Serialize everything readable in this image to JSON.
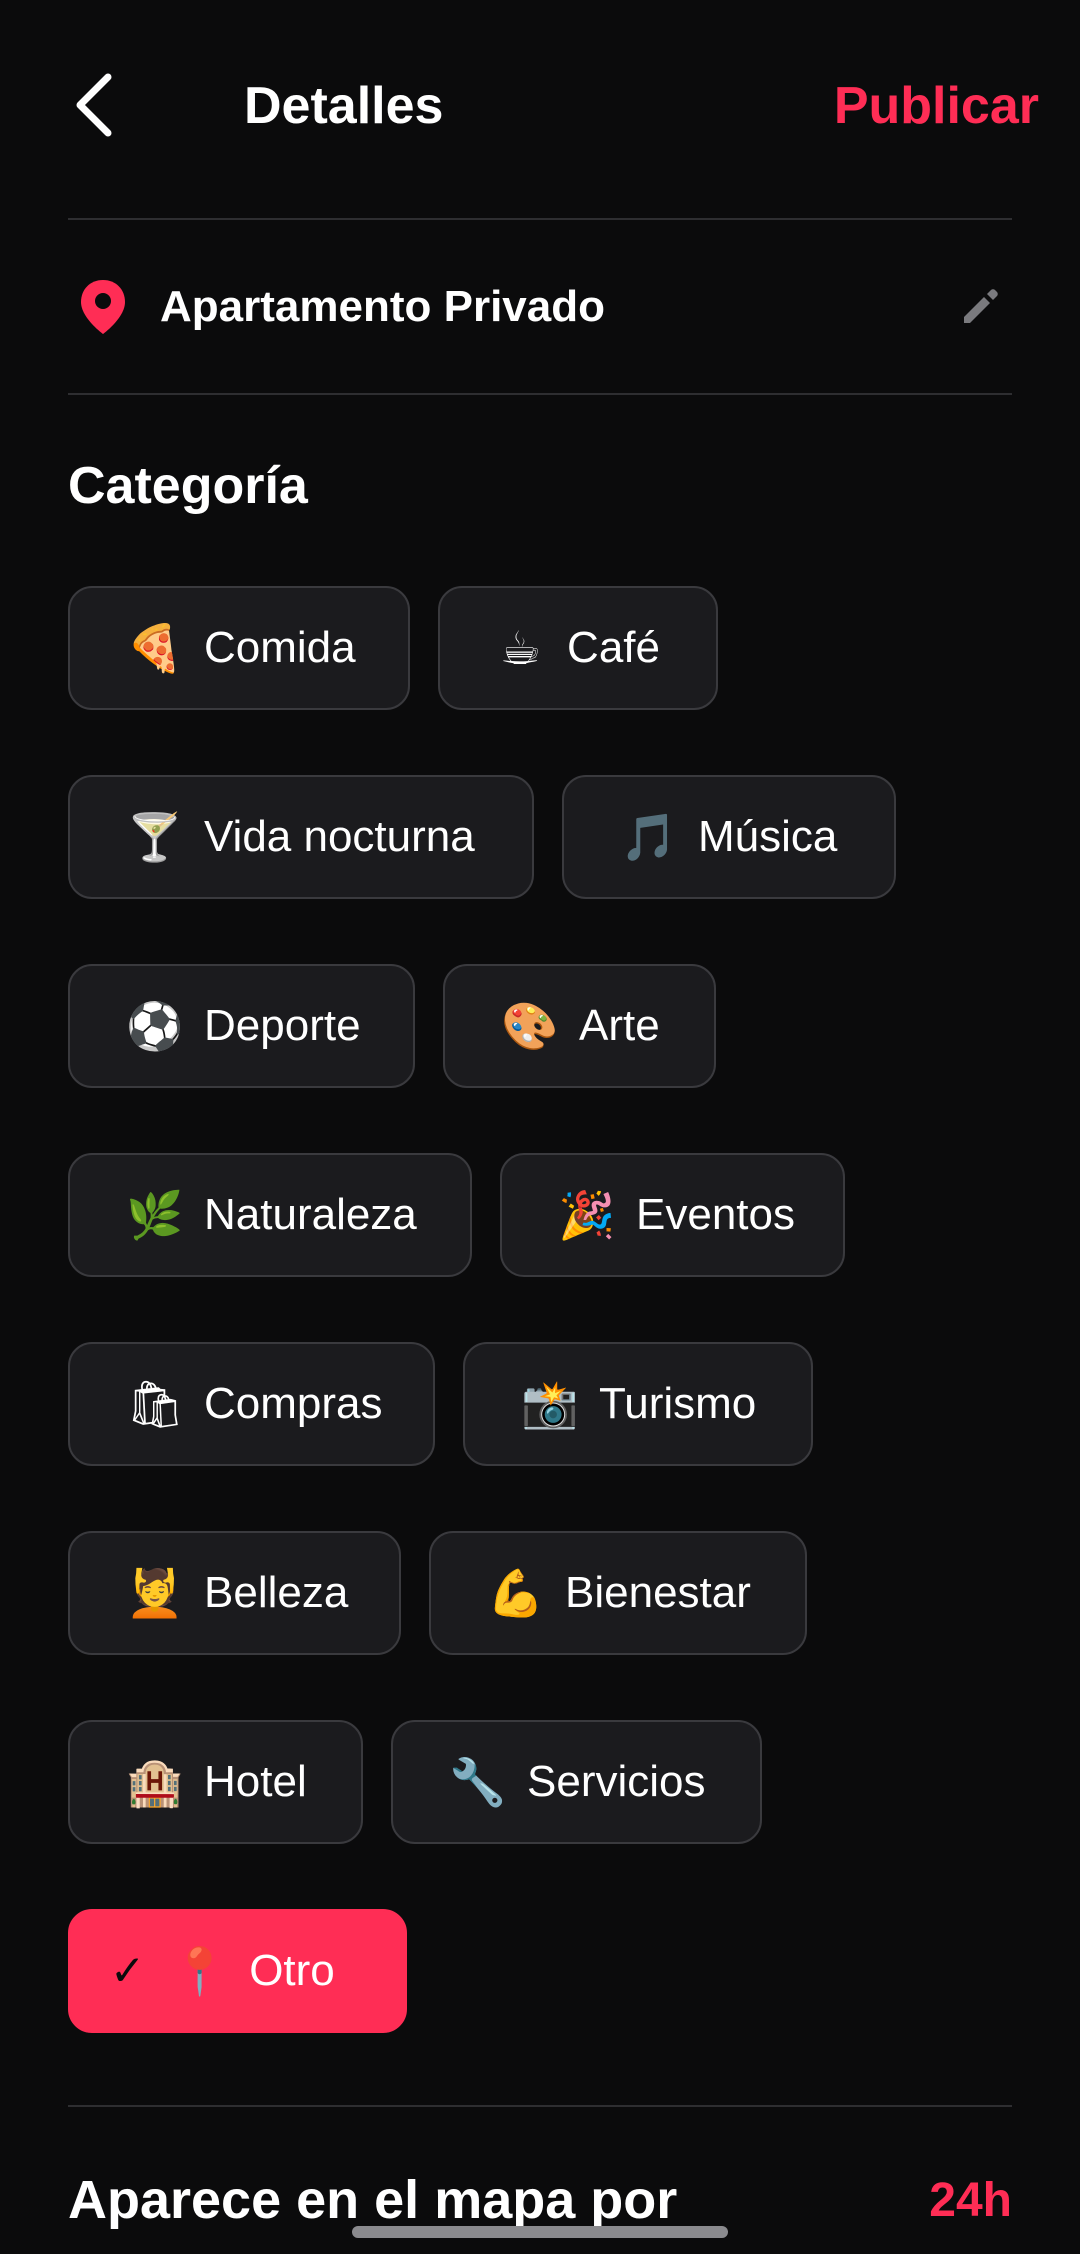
{
  "header": {
    "title": "Detalles",
    "publish_label": "Publicar",
    "back_icon": "chevron-left-icon"
  },
  "place": {
    "name": "Apartamento Privado",
    "pin_icon": "location-pin-icon",
    "edit_icon": "pencil-icon"
  },
  "category": {
    "title": "Categoría",
    "items": [
      {
        "emoji": "🍕",
        "label": "Comida",
        "selected": false
      },
      {
        "emoji": "☕",
        "label": "Café",
        "selected": false
      },
      {
        "emoji": "🍸",
        "label": "Vida nocturna",
        "selected": false
      },
      {
        "emoji": "🎵",
        "label": "Música",
        "selected": false
      },
      {
        "emoji": "⚽",
        "label": "Deporte",
        "selected": false
      },
      {
        "emoji": "🎨",
        "label": "Arte",
        "selected": false
      },
      {
        "emoji": "🌿",
        "label": "Naturaleza",
        "selected": false
      },
      {
        "emoji": "🎉",
        "label": "Eventos",
        "selected": false
      },
      {
        "emoji": "🛍",
        "label": "Compras",
        "selected": false
      },
      {
        "emoji": "📸",
        "label": "Turismo",
        "selected": false
      },
      {
        "emoji": "💆",
        "label": "Belleza",
        "selected": false
      },
      {
        "emoji": "💪",
        "label": "Bienestar",
        "selected": false
      },
      {
        "emoji": "🏨",
        "label": "Hotel",
        "selected": false
      },
      {
        "emoji": "🔧",
        "label": "Servicios",
        "selected": false
      },
      {
        "emoji": "📍",
        "label": "Otro",
        "selected": true,
        "check": "✓"
      }
    ]
  },
  "visibility": {
    "title": "Aparece en el mapa por",
    "value": "24h"
  },
  "colors": {
    "accent": "#ff2d55",
    "background": "#0b0b0c",
    "chip_bg": "#1b1b1e",
    "chip_border": "#3a3a3e"
  }
}
